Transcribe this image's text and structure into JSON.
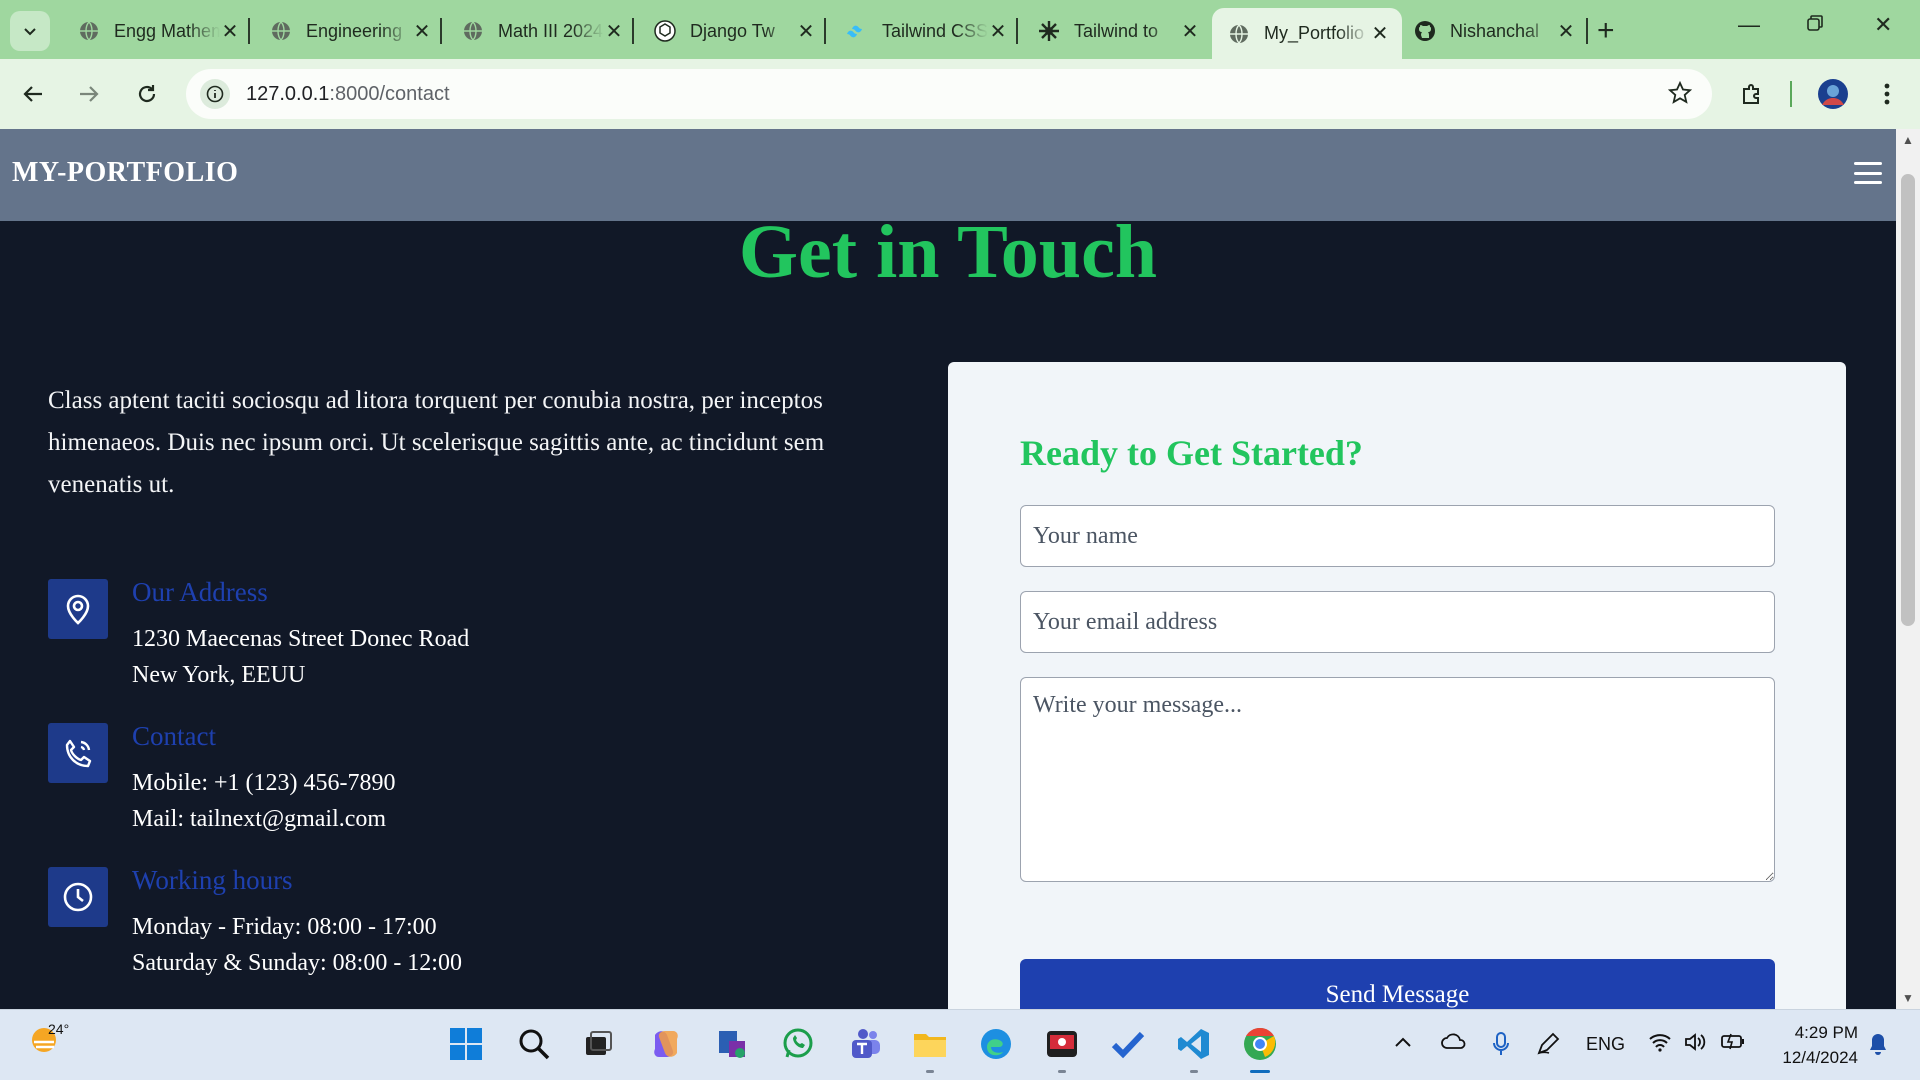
{
  "browser": {
    "tabs": [
      {
        "title": "Engg Mathematics",
        "favicon": "globe-icon"
      },
      {
        "title": "Engineering",
        "favicon": "globe-icon"
      },
      {
        "title": "Math III 2024",
        "favicon": "globe-icon"
      },
      {
        "title": "Django Tw",
        "favicon": "chatgpt-icon"
      },
      {
        "title": "Tailwind CSS",
        "favicon": "tailwind-icon"
      },
      {
        "title": "Tailwind to",
        "favicon": "gear-icon"
      },
      {
        "title": "My_Portfolio",
        "favicon": "globe-icon",
        "active": true
      },
      {
        "title": "Nishanchal",
        "favicon": "github-icon"
      }
    ],
    "url_host": "127.0.0.1",
    "url_path": ":8000/contact",
    "accent": "#9fd79f"
  },
  "page": {
    "brand": "MY-PORTFOLIO",
    "hero_title": "Get in Touch",
    "intro": "Class aptent taciti sociosqu ad litora torquent per conubia nostra, per inceptos himenaeos. Duis nec ipsum orci. Ut scelerisque sagittis ante, ac tincidunt sem venenatis ut.",
    "address": {
      "title": "Our Address",
      "line1": "1230 Maecenas Street Donec Road",
      "line2": "New York, EEUU",
      "icon": "map-pin-icon"
    },
    "contact": {
      "title": "Contact",
      "line1": "Mobile: +1 (123) 456-7890",
      "line2": "Mail: tailnext@gmail.com",
      "icon": "phone-icon"
    },
    "hours": {
      "title": "Working hours",
      "line1": "Monday - Friday: 08:00 - 17:00",
      "line2": "Saturday & Sunday: 08:00 - 12:00",
      "icon": "clock-icon"
    },
    "form": {
      "heading": "Ready to Get Started?",
      "name_placeholder": "Your name",
      "email_placeholder": "Your email address",
      "message_placeholder": "Write your message...",
      "submit_label": "Send Message"
    },
    "colors": {
      "navbar": "#64748b",
      "background": "#111827",
      "heading": "#22c55e",
      "primary": "#1e40af"
    }
  },
  "taskbar": {
    "temperature": "24°",
    "language": "ENG",
    "time": "4:29 PM",
    "date": "12/4/2024"
  }
}
